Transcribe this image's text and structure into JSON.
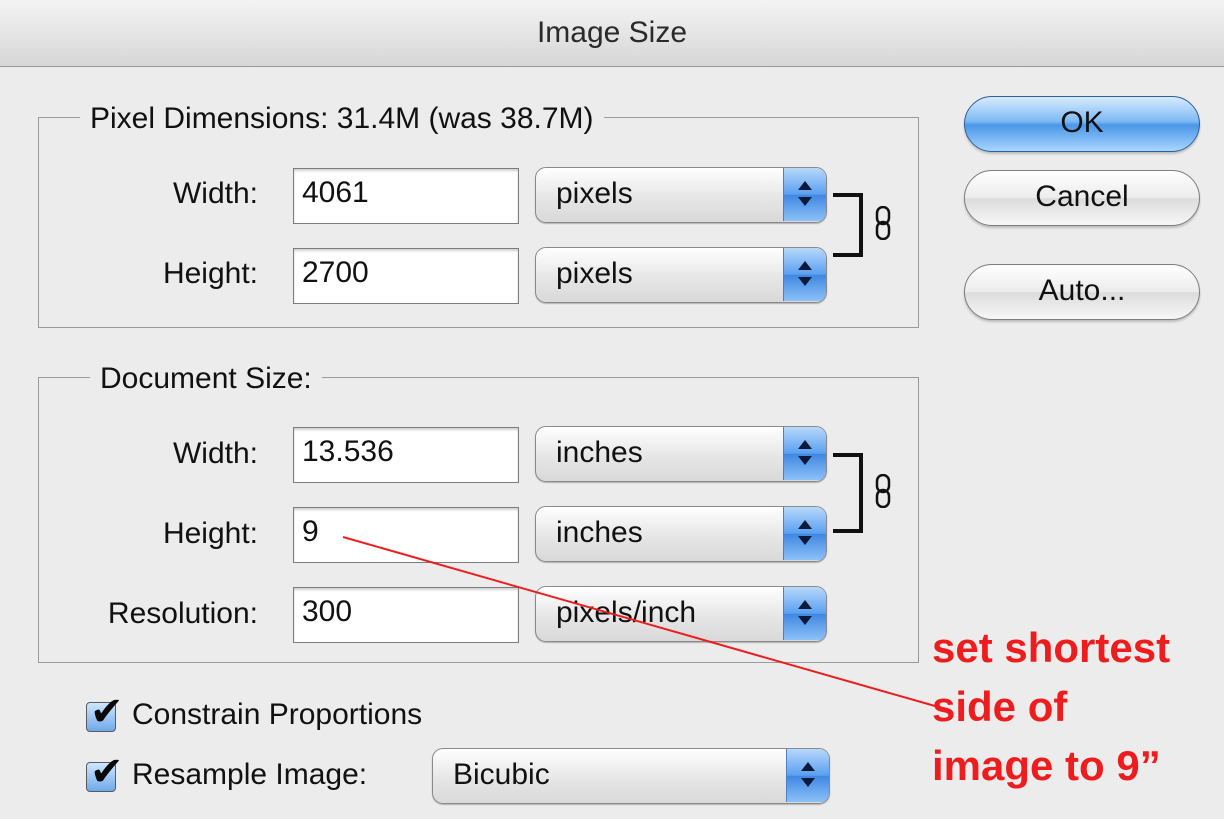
{
  "window": {
    "title": "Image Size"
  },
  "pixel_dimensions": {
    "legend": "Pixel Dimensions:  31.4M (was 38.7M)",
    "width": {
      "label": "Width:",
      "value": "4061",
      "unit": "pixels"
    },
    "height": {
      "label": "Height:",
      "value": "2700",
      "unit": "pixels"
    }
  },
  "document_size": {
    "legend": "Document Size:",
    "width": {
      "label": "Width:",
      "value": "13.536",
      "unit": "inches"
    },
    "height": {
      "label": "Height:",
      "value": "9",
      "unit": "inches"
    },
    "resolution": {
      "label": "Resolution:",
      "value": "300",
      "unit": "pixels/inch"
    }
  },
  "buttons": {
    "ok": "OK",
    "cancel": "Cancel",
    "auto": "Auto..."
  },
  "options": {
    "constrain": {
      "label": "Constrain Proportions",
      "checked": true
    },
    "resample": {
      "label": "Resample Image:",
      "checked": true,
      "method": "Bicubic"
    }
  },
  "icons": {
    "link": "chain-link-icon",
    "check": "checkmark-icon",
    "popup_arrows": "up-down-arrows-icon"
  },
  "annotation": {
    "lines": [
      "set shortest",
      "side of",
      "image to 9”"
    ],
    "color": "#ee1c1c"
  },
  "colors": {
    "accent": "#4a97e8",
    "window_bg": "#ececec"
  }
}
